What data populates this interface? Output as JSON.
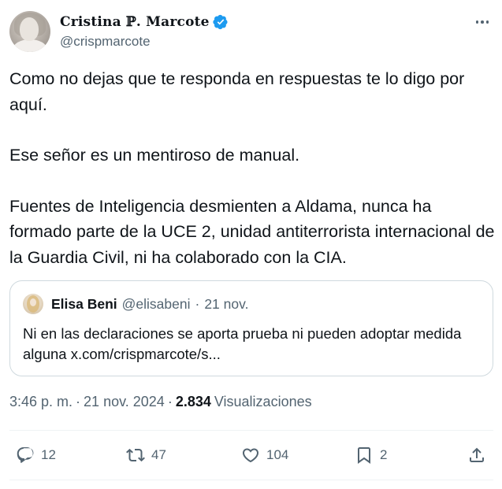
{
  "author": {
    "display_name": "𝐂𝐫𝐢𝐬𝐭𝐢𝐧𝐚 ℙ. 𝐌𝐚𝐫𝐜𝐨𝐭𝐞",
    "handle": "@crispmarcote",
    "verified": true
  },
  "tweet": {
    "paragraphs": [
      "Como no dejas que te responda en respuestas te lo digo por aquí.",
      "Ese señor es un mentiroso de manual.",
      "Fuentes de Inteligencia desmienten a Aldama, nunca ha formado parte de la UCE 2, unidad antiterrorista internacional de la Guardia Civil, ni ha colaborado con la CIA."
    ]
  },
  "quote": {
    "name": "Elisa Beni",
    "handle": "@elisabeni",
    "separator": "·",
    "date": "21 nov.",
    "text": "Ni en las declaraciones se aporta prueba ni pueden adoptar medida alguna x.com/crispmarcote/s..."
  },
  "meta": {
    "time": "3:46 p. m.",
    "separator": "·",
    "date": "21 nov. 2024",
    "views_count": "2.834",
    "views_label": "Visualizaciones"
  },
  "actions": {
    "replies": "12",
    "reposts": "47",
    "likes": "104",
    "bookmarks": "2"
  },
  "colors": {
    "text": "#0f1419",
    "secondary": "#536471",
    "verified": "#1d9bf0",
    "border": "#cfd9de"
  }
}
